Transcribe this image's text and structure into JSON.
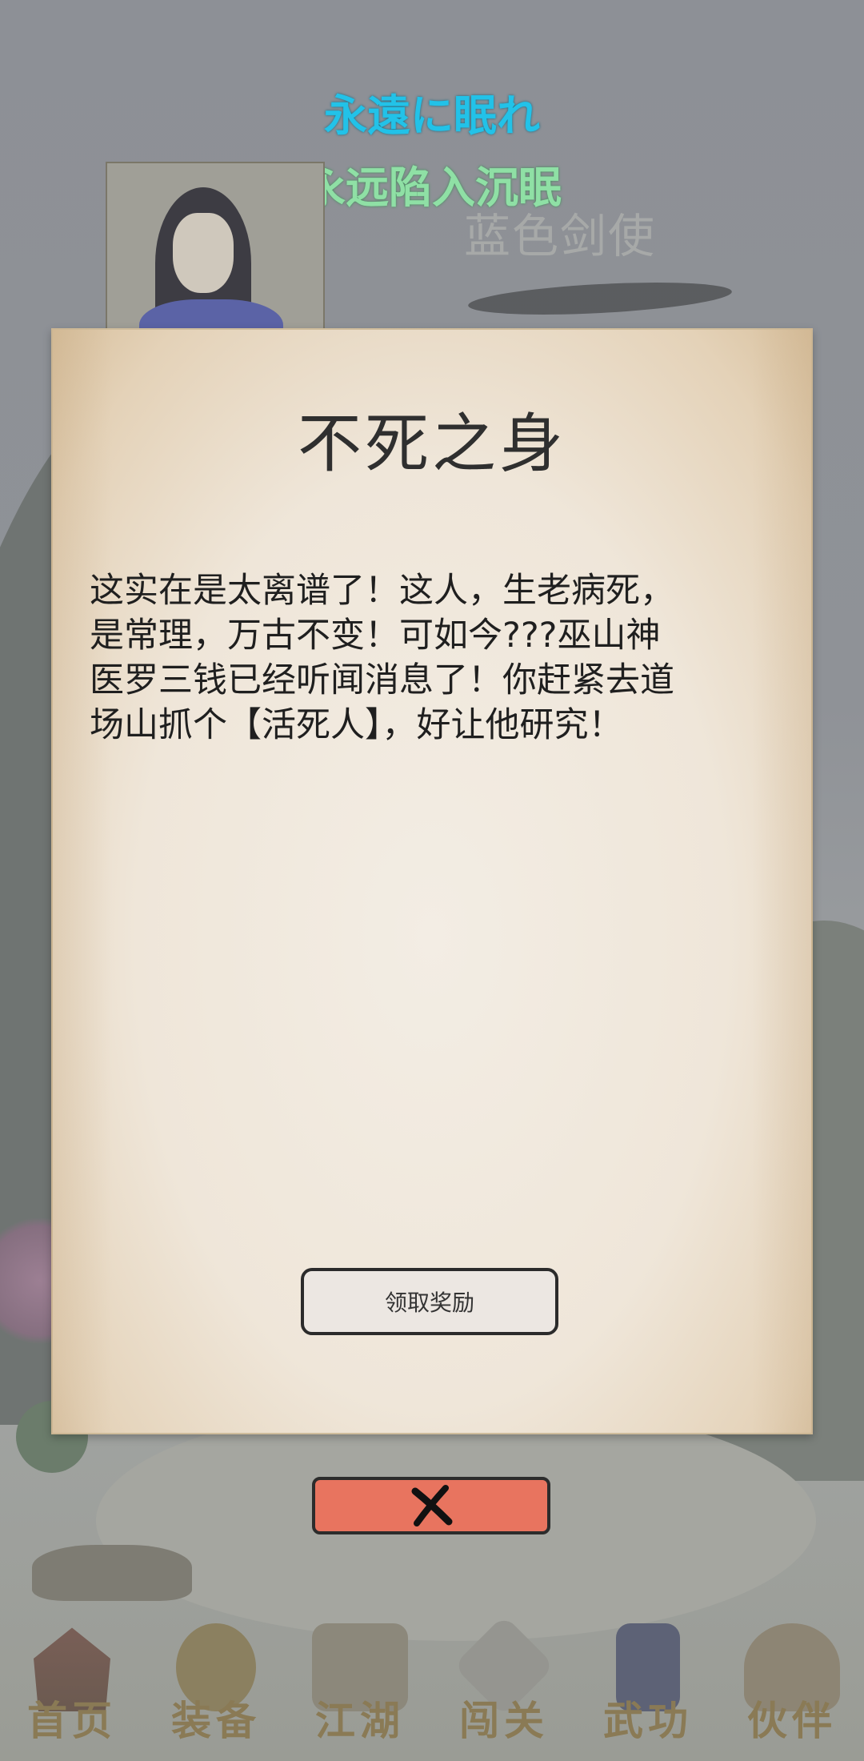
{
  "header": {
    "title_jp": "永遠に眠れ",
    "title_cn": "永远陷入沉眠",
    "character_name": "蓝色剑使"
  },
  "dialog": {
    "title": "不死之身",
    "body": "这实在是太离谱了！这人，生老病死，\n是常理，万古不变！可如今???巫山神\n医罗三钱已经听闻消息了！你赶紧去道\n场山抓个【活死人】，好让他研究！",
    "claim_button": "领取奖励"
  },
  "close_button": {
    "icon": "close-x-icon",
    "color": "#e8745f"
  },
  "nav": {
    "items": [
      {
        "label": "首页",
        "icon": "pagoda-icon"
      },
      {
        "label": "装备",
        "icon": "armor-icon"
      },
      {
        "label": "江湖",
        "icon": "gate-icon"
      },
      {
        "label": "闯关",
        "icon": "crossed-swords-icon"
      },
      {
        "label": "武功",
        "icon": "scroll-book-icon"
      },
      {
        "label": "伙伴",
        "icon": "people-icon"
      }
    ]
  },
  "colors": {
    "title_jp": "#22c2e8",
    "title_cn": "#8fe0a5",
    "nav_label": "#8a7a55"
  }
}
